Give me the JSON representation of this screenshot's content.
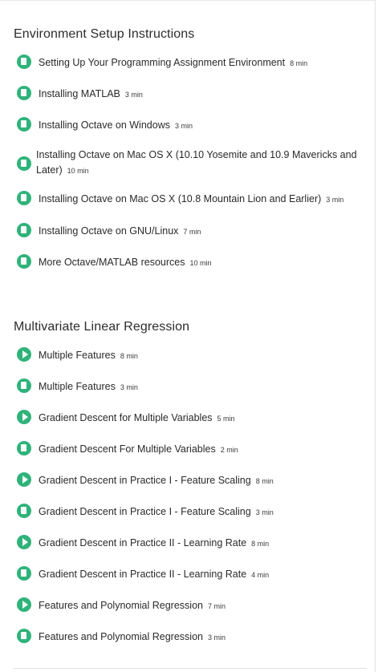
{
  "sections": [
    {
      "title": "Environment Setup Instructions",
      "items": [
        {
          "type": "reading",
          "label": "Setting Up Your Programming Assignment Environment",
          "duration": "8 min"
        },
        {
          "type": "reading",
          "label": "Installing MATLAB",
          "duration": "3 min"
        },
        {
          "type": "reading",
          "label": "Installing Octave on Windows",
          "duration": "3 min"
        },
        {
          "type": "reading",
          "label": "Installing Octave on Mac OS X (10.10 Yosemite and 10.9 Mavericks and Later)",
          "duration": "10 min"
        },
        {
          "type": "reading",
          "label": "Installing Octave on Mac OS X (10.8 Mountain Lion and Earlier)",
          "duration": "3 min"
        },
        {
          "type": "reading",
          "label": "Installing Octave on GNU/Linux",
          "duration": "7 min"
        },
        {
          "type": "reading",
          "label": "More Octave/MATLAB resources",
          "duration": "10 min"
        }
      ]
    },
    {
      "title": "Multivariate Linear Regression",
      "items": [
        {
          "type": "video",
          "label": "Multiple Features",
          "duration": "8 min"
        },
        {
          "type": "reading",
          "label": "Multiple Features",
          "duration": "3 min"
        },
        {
          "type": "video",
          "label": "Gradient Descent for Multiple Variables",
          "duration": "5 min"
        },
        {
          "type": "reading",
          "label": "Gradient Descent For Multiple Variables",
          "duration": "2 min"
        },
        {
          "type": "video",
          "label": "Gradient Descent in Practice I - Feature Scaling",
          "duration": "8 min"
        },
        {
          "type": "reading",
          "label": "Gradient Descent in Practice I - Feature Scaling",
          "duration": "3 min"
        },
        {
          "type": "video",
          "label": "Gradient Descent in Practice II - Learning Rate",
          "duration": "8 min"
        },
        {
          "type": "reading",
          "label": "Gradient Descent in Practice II - Learning Rate",
          "duration": "4 min"
        },
        {
          "type": "video",
          "label": "Features and Polynomial Regression",
          "duration": "7 min"
        },
        {
          "type": "reading",
          "label": "Features and Polynomial Regression",
          "duration": "3 min"
        }
      ]
    }
  ]
}
